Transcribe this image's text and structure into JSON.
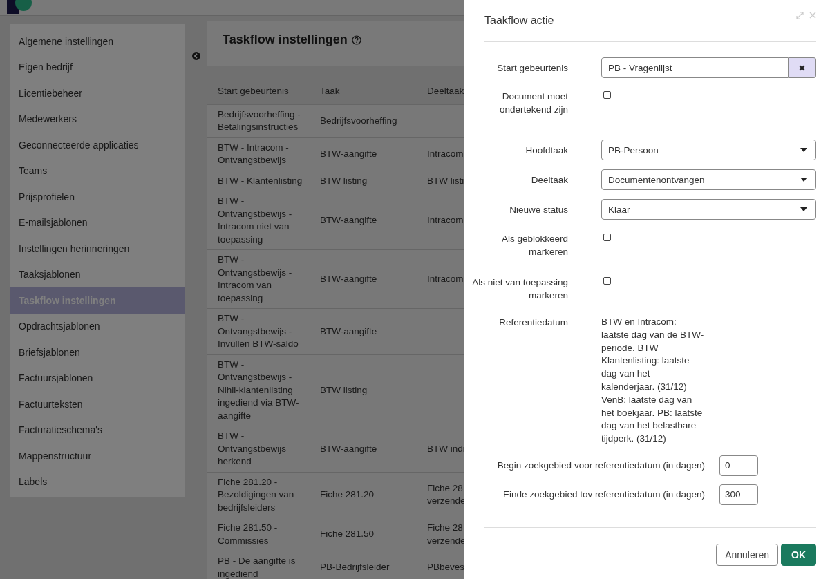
{
  "sidebar": {
    "items": [
      {
        "label": "Algemene instellingen",
        "selected": false
      },
      {
        "label": "Eigen bedrijf",
        "selected": false
      },
      {
        "label": "Licentiebeheer",
        "selected": false
      },
      {
        "label": "Medewerkers",
        "selected": false
      },
      {
        "label": "Geconnecteerde applicaties",
        "selected": false
      },
      {
        "label": "Teams",
        "selected": false
      },
      {
        "label": "Prijsprofielen",
        "selected": false
      },
      {
        "label": "E-mailsjablonen",
        "selected": false
      },
      {
        "label": "Instellingen herinneringen",
        "selected": false
      },
      {
        "label": "Taaksjablonen",
        "selected": false
      },
      {
        "label": "Taskflow instellingen",
        "selected": true
      },
      {
        "label": "Opdrachtsjablonen",
        "selected": false
      },
      {
        "label": "Briefsjablonen",
        "selected": false
      },
      {
        "label": "Factuursjablonen",
        "selected": false
      },
      {
        "label": "Factuurteksten",
        "selected": false
      },
      {
        "label": "Facturatieschema's",
        "selected": false
      },
      {
        "label": "Mappenstructuur",
        "selected": false
      },
      {
        "label": "Labels",
        "selected": false
      }
    ]
  },
  "main": {
    "title": "Taskflow instellingen",
    "table": {
      "columns": [
        "Start gebeurtenis",
        "Taak",
        "Deeltaak"
      ],
      "rows": [
        [
          "Bedrijfsvoorheffing - Betalingsinstructies",
          "Bedrijfsvoorheffing",
          ""
        ],
        [
          "BTW - Intracom - Ontvangstbewijs",
          "BTW-aangifte",
          "Intracom"
        ],
        [
          "BTW - Klantenlisting",
          "BTW listing",
          "BTW listi"
        ],
        [
          "BTW - Ontvangstbewijs - Intracom niet van toepassing",
          "BTW-aangifte",
          "Intracom"
        ],
        [
          "BTW - Ontvangstbewijs - Intracom van toepassing",
          "BTW-aangifte",
          "Intracom"
        ],
        [
          "BTW - Ontvangstbewijs - Invullen BTW-saldo",
          "BTW-aangifte",
          ""
        ],
        [
          "BTW - Ontvangstbewijs - Nihil-klantenlisting ingediend via BTW-aangifte",
          "BTW listing",
          ""
        ],
        [
          "BTW - Ontvangstbewijs herkend",
          "BTW-aangifte",
          "BTW indi"
        ],
        [
          "Fiche 281.20 - Bezoldigingen van bedrijfsleiders",
          "Fiche 281.20",
          "Fiche 28\nverzende"
        ],
        [
          "Fiche 281.50 - Commissies",
          "Fiche 281.50",
          "Fiche 28\nverzende"
        ],
        [
          "PB - De aangifte is ingediend",
          "PB-Bedrijfsleider",
          "PBbeves"
        ]
      ]
    }
  },
  "dialog": {
    "title": "Taakflow actie",
    "start_event": {
      "label": "Start gebeurtenis",
      "value": "PB - Vragenlijst"
    },
    "must_sign": {
      "label": "Document moet ondertekend zijn",
      "checked": false
    },
    "selects": [
      {
        "label": "Hoofdtaak",
        "value": "PB-Persoon"
      },
      {
        "label": "Deeltaak",
        "value": "Documentenontvangen"
      },
      {
        "label": "Nieuwe status",
        "value": "Klaar"
      }
    ],
    "checkboxes": [
      {
        "label": "Als geblokkeerd markeren",
        "checked": false
      },
      {
        "label": "Als niet van toepassing markeren",
        "checked": false
      }
    ],
    "reference": {
      "label": "Referentiedatum",
      "text": "BTW en Intracom: laatste dag van de BTW-periode. BTW Klantenlisting: laatste dag van het kalenderjaar. (31/12) VenB: laatste dag van het boekjaar. PB: laatste dag van het belastbare tijdperk. (31/12)"
    },
    "ranges": [
      {
        "label": "Begin zoekgebied voor referentiedatum (in dagen)",
        "value": "0"
      },
      {
        "label": "Einde zoekgebied tov referentiedatum (in dagen)",
        "value": "300"
      }
    ],
    "buttons": {
      "cancel": "Annuleren",
      "ok": "OK"
    }
  }
}
